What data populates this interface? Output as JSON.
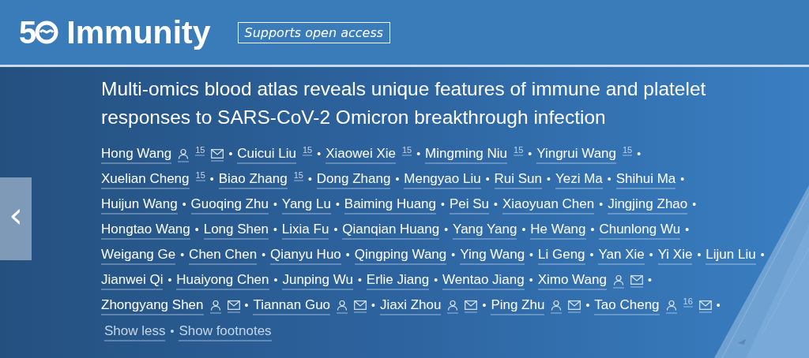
{
  "header": {
    "logo_number": "5",
    "journal": "Immunity",
    "badge": "Supports open access"
  },
  "carousel": {
    "prev": "‹"
  },
  "article": {
    "title": "Multi-omics blood atlas reveals unique features of immune and platelet responses to SARS-CoV-2 Omicron breakthrough infection",
    "separator": "•",
    "author_rows": [
      [
        {
          "name": "Hong Wang",
          "profile": true,
          "note": "15",
          "email": true
        },
        {
          "name": "Cuicui Liu",
          "note": "15"
        },
        {
          "name": "Xiaowei Xie",
          "note": "15"
        },
        {
          "name": "Mingming Niu",
          "note": "15"
        },
        {
          "name": "Yingrui Wang",
          "note": "15"
        }
      ],
      [
        {
          "name": "Xuelian Cheng",
          "note": "15"
        },
        {
          "name": "Biao Zhang",
          "note": "15"
        },
        {
          "name": "Dong Zhang"
        },
        {
          "name": "Mengyao Liu"
        },
        {
          "name": "Rui Sun"
        },
        {
          "name": "Yezi Ma"
        },
        {
          "name": "Shihui Ma"
        }
      ],
      [
        {
          "name": "Huijun Wang"
        },
        {
          "name": "Guoqing Zhu"
        },
        {
          "name": "Yang Lu"
        },
        {
          "name": "Baiming Huang"
        },
        {
          "name": "Pei Su"
        },
        {
          "name": "Xiaoyuan Chen"
        },
        {
          "name": "Jingjing Zhao"
        }
      ],
      [
        {
          "name": "Hongtao Wang"
        },
        {
          "name": "Long Shen"
        },
        {
          "name": "Lixia Fu"
        },
        {
          "name": "Qianqian Huang"
        },
        {
          "name": "Yang Yang"
        },
        {
          "name": "He Wang"
        },
        {
          "name": "Chunlong Wu"
        }
      ],
      [
        {
          "name": "Weigang Ge"
        },
        {
          "name": "Chen Chen"
        },
        {
          "name": "Qianyu Huo"
        },
        {
          "name": "Qingping Wang"
        },
        {
          "name": "Ying Wang"
        },
        {
          "name": "Li Geng"
        },
        {
          "name": "Yan Xie"
        },
        {
          "name": "Yi Xie"
        },
        {
          "name": "Lijun Liu"
        }
      ],
      [
        {
          "name": "Jianwei Qi"
        },
        {
          "name": "Huaiyong Chen"
        },
        {
          "name": "Junping Wu"
        },
        {
          "name": "Erlie Jiang"
        },
        {
          "name": "Wentao Jiang"
        },
        {
          "name": "Ximo Wang",
          "profile": true,
          "email": true
        }
      ],
      [
        {
          "name": "Zhongyang Shen",
          "profile": true,
          "email": true
        },
        {
          "name": "Tiannan Guo",
          "profile": true,
          "email": true
        },
        {
          "name": "Jiaxi Zhou",
          "profile": true,
          "email": true
        },
        {
          "name": "Ping Zhu",
          "profile": true,
          "email": true
        },
        {
          "name": "Tao Cheng",
          "profile": true,
          "note": "16",
          "email": true
        }
      ]
    ],
    "links": [
      "Show less",
      "Show footnotes"
    ]
  }
}
